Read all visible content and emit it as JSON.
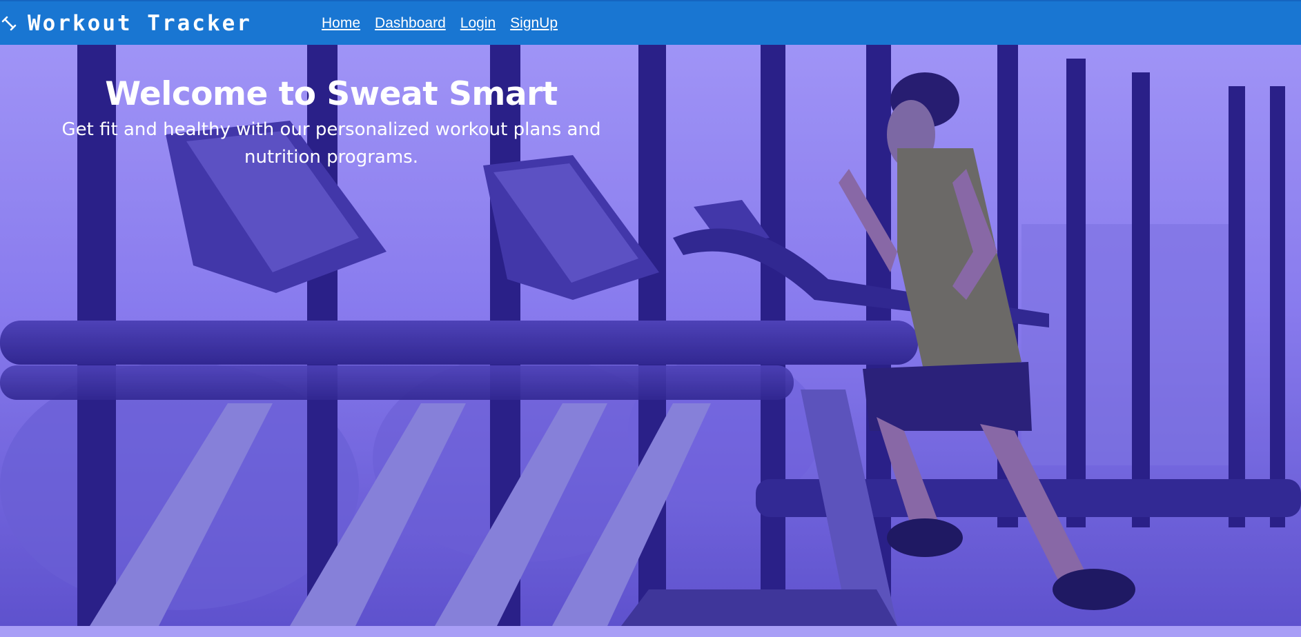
{
  "navbar": {
    "brand_icon": "dumbbell-icon",
    "brand_title": "Workout Tracker",
    "links": [
      {
        "label": "Home"
      },
      {
        "label": "Dashboard"
      },
      {
        "label": "Login"
      },
      {
        "label": "SignUp"
      }
    ],
    "background_color": "#1976d2"
  },
  "hero": {
    "title": "Welcome to Sweat Smart",
    "subtitle": "Get fit and healthy with our personalized workout plans and nutrition programs.",
    "image": "gym-treadmill-runner-photo",
    "overlay_color": "#6b5cf0"
  }
}
